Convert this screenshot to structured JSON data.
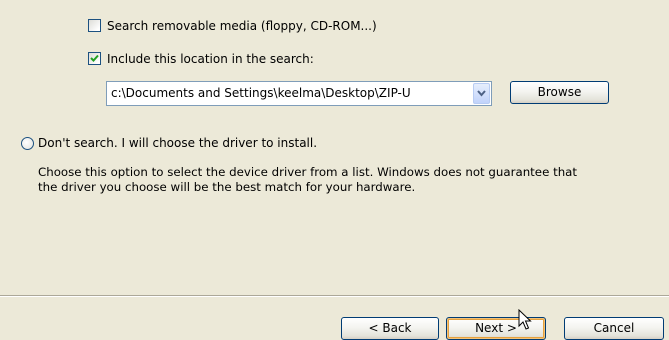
{
  "search_options": {
    "removable_media": {
      "label": "Search removable media (floppy, CD-ROM...)",
      "checked": false
    },
    "include_location": {
      "label": "Include this location in the search:",
      "checked": true
    },
    "location": {
      "value": "c:\\Documents and Settings\\keelma\\Desktop\\ZIP-U",
      "dropdown_icon": "chevron-down-icon"
    },
    "browse_label": "Browse"
  },
  "dont_search": {
    "label": "Don't search. I will choose the driver to install.",
    "selected": false,
    "description_line1": "Choose this option to select the device driver from a list.  Windows does not guarantee that",
    "description_line2": "the driver you choose will be the best match for your hardware."
  },
  "buttons": {
    "back": "< Back",
    "next": "Next >",
    "cancel": "Cancel"
  },
  "cursor": {
    "icon": "mouse-pointer-icon"
  },
  "colors": {
    "dialog_background": "#ECE9D8",
    "check_mark": "#21A121",
    "button_border": "#003C74",
    "default_button_highlight": "#E5A23F"
  }
}
